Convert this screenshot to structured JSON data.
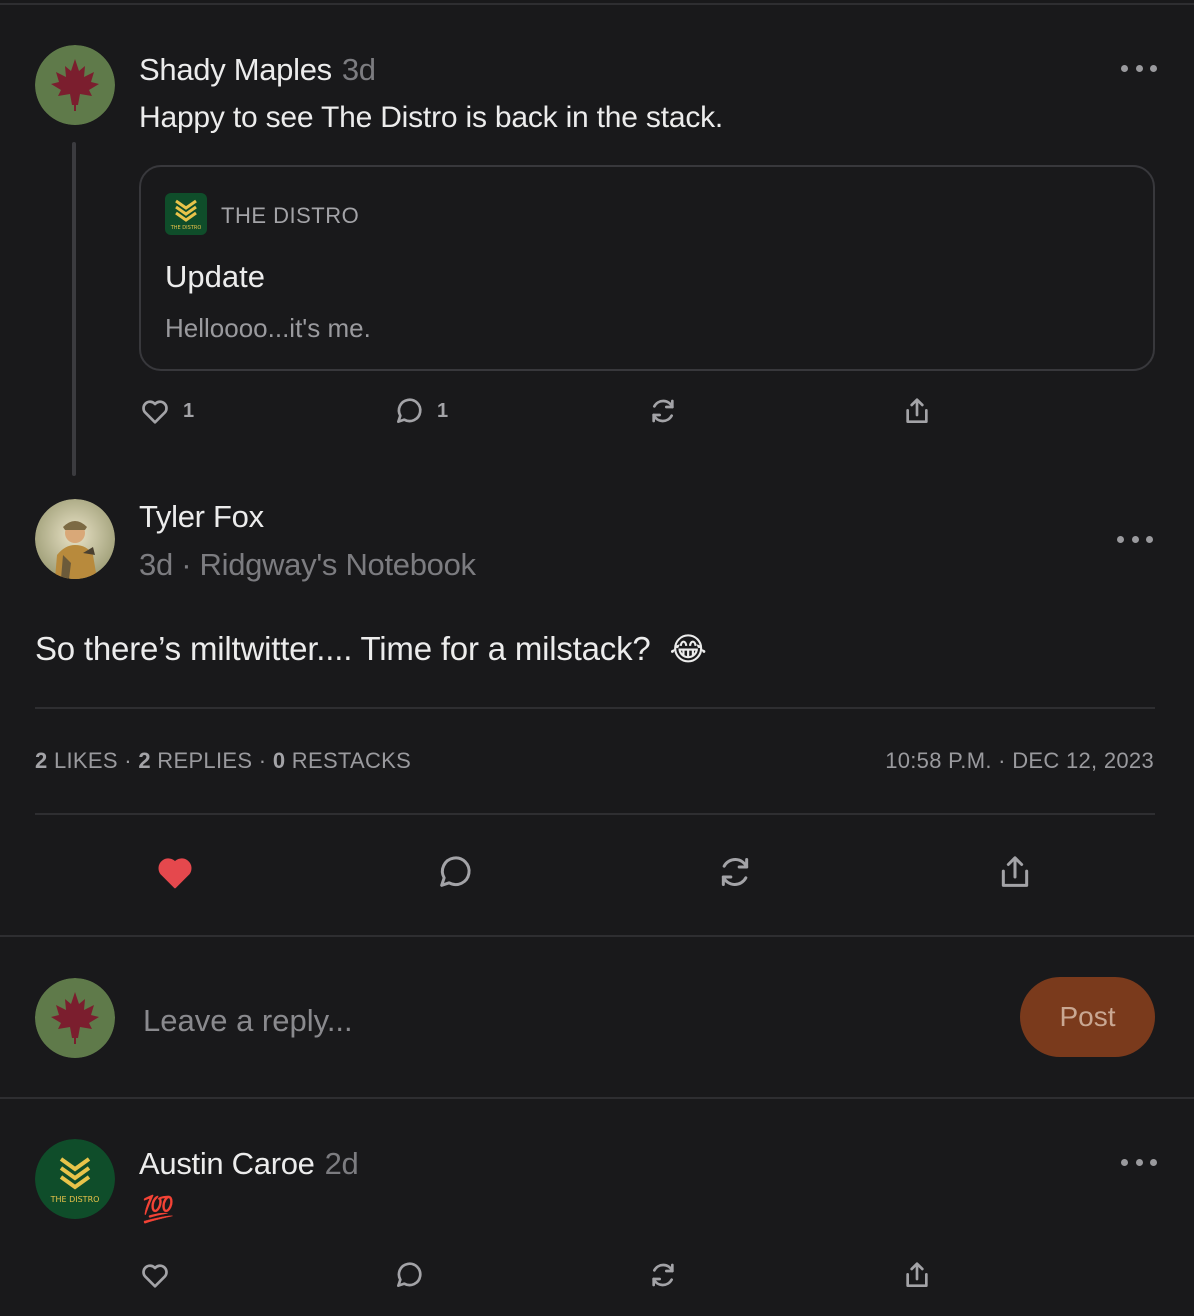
{
  "comment1": {
    "author": "Shady Maples",
    "time": "3d",
    "text": "Happy to see The Distro is back in the stack.",
    "quote": {
      "publication": "THE DISTRO",
      "title": "Update",
      "subtitle": "Helloooo...it's me."
    },
    "likes": "1",
    "replies": "1"
  },
  "main_post": {
    "author": "Tyler Fox",
    "meta": "3d · Ridgway's Notebook",
    "text": "So there’s miltwitter.... Time for a milstack?",
    "emoji": "😂",
    "stats": {
      "likes_count": "2",
      "likes_label": "LIKES",
      "replies_count": "2",
      "replies_label": "REPLIES",
      "restacks_count": "0",
      "restacks_label": "RESTACKS",
      "separator": "·"
    },
    "timestamp": "10:58 P.M. · DEC 12, 2023",
    "liked": true
  },
  "reply_box": {
    "placeholder": "Leave a reply...",
    "post_label": "Post"
  },
  "comment2": {
    "author": "Austin Caroe",
    "time": "2d",
    "emoji": "💯"
  },
  "logo_text": "THE DISTRO",
  "colors": {
    "background": "#19191b",
    "like_active": "#e5484d",
    "post_button": "#7a3a1c",
    "distro_green": "#0f4d2a",
    "distro_gold": "#e8c34a",
    "maple_bg": "#5f7a4a",
    "maple_leaf": "#7b1e2e"
  },
  "icons": [
    "heart-icon",
    "comment-icon",
    "restack-icon",
    "share-icon",
    "more-icon",
    "maple-leaf-icon",
    "chevrons-icon"
  ]
}
